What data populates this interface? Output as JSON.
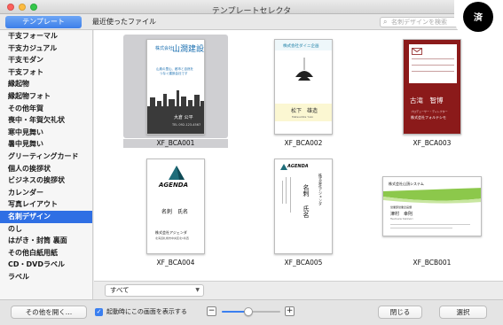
{
  "window": {
    "title": "テンプレートセレクタ"
  },
  "badge": {
    "text": "済"
  },
  "tabs": {
    "selected": "テンプレート",
    "recent": "最近使ったファイル"
  },
  "search": {
    "placeholder": "名刺デザインを検索"
  },
  "sidebar": {
    "items": [
      {
        "label": "干支フォーマル"
      },
      {
        "label": "干支カジュアル"
      },
      {
        "label": "干支モダン"
      },
      {
        "label": "干支フォト"
      },
      {
        "label": "縁起物"
      },
      {
        "label": "縁起物フォト"
      },
      {
        "label": "その他年賀"
      },
      {
        "label": "喪中・年賀欠礼状"
      },
      {
        "label": "寒中見舞い"
      },
      {
        "label": "暑中見舞い"
      },
      {
        "label": "グリーティングカード"
      },
      {
        "label": "個人の挨拶状"
      },
      {
        "label": "ビジネスの挨拶状"
      },
      {
        "label": "カレンダー"
      },
      {
        "label": "写真レイアウト"
      },
      {
        "label": "名刺デザイン"
      },
      {
        "label": "のし"
      },
      {
        "label": "はがき・封筒 裏面"
      },
      {
        "label": "その他白紙用紙"
      },
      {
        "label": "CD・DVDラベル"
      },
      {
        "label": "ラベル"
      }
    ],
    "active_index": 15
  },
  "templates": [
    {
      "name": "XF_BCA001",
      "selected": true,
      "company": "株式会社",
      "company_big": "山澗建設",
      "name_jp": "大倉 公平",
      "tel": "TEL 092-123-4567",
      "tagline1": "山奥の里山、都市と自然を",
      "tagline2": "つなぐ建設会社です"
    },
    {
      "name": "XF_BCA002",
      "selected": false,
      "company": "株式会社ダイニ企画",
      "name_jp": "松下　雄造",
      "name_en": "Matsushita Yuzo"
    },
    {
      "name": "XF_BCA003",
      "selected": false,
      "name_jp": "古滝　智博",
      "company": "株式会社フォルテシモ",
      "title": "プロデューサー・ディレクター"
    },
    {
      "name": "XF_BCA004",
      "selected": false,
      "logo": "AGENDA",
      "name_jp": "名刺　氏名",
      "company": "株式会社アジェンダ",
      "address": "北海道札幌市中央区北1条西"
    },
    {
      "name": "XF_BCA005",
      "selected": false,
      "logo": "AGENDA",
      "v_company": "株式会社アジェンダ",
      "v_name1": "名刺",
      "v_name2": "氏名"
    },
    {
      "name": "XF_BCB001",
      "selected": false,
      "company": "株式会社山頂システム",
      "name_jp": "津村　幸則",
      "name_en": "Tsumura Yukinori",
      "dept": "営業部営業企画課"
    }
  ],
  "filter": {
    "value": "すべて"
  },
  "bottom": {
    "other_button": "その他を開く…",
    "checkbox_label": "起動時にこの画面を表示する",
    "checkbox_checked": true,
    "zoom": 0.45,
    "close_button": "閉じる",
    "select_button": "選択"
  },
  "colors": {
    "accent": "#2f6fe4",
    "bca003_red": "#8b1a1a",
    "bca002_teal": "#1b7fa6",
    "bcb001_green": "#8cc84b",
    "agenda_teal": "#1f6d7a"
  }
}
